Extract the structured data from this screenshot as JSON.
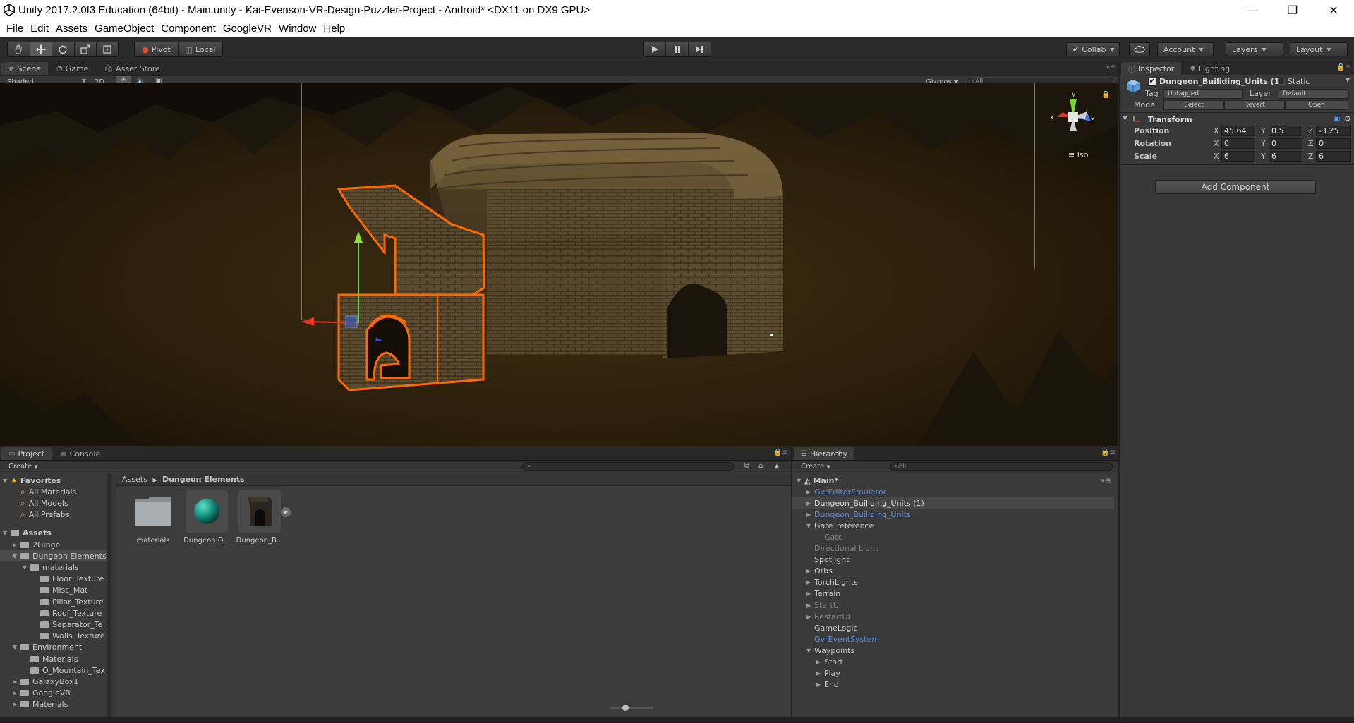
{
  "window": {
    "title": "Unity 2017.2.0f3 Education (64bit) - Main.unity - Kai-Evenson-VR-Design-Puzzler-Project - Android* <DX11 on DX9 GPU>",
    "minimize": "—",
    "restore": "❐",
    "close": "✕"
  },
  "menu": [
    "File",
    "Edit",
    "Assets",
    "GameObject",
    "Component",
    "GoogleVR",
    "Window",
    "Help"
  ],
  "toolbar": {
    "pivot": "Pivot",
    "local": "Local",
    "collab": "Collab",
    "account": "Account",
    "layers": "Layers",
    "layout": "Layout"
  },
  "scene": {
    "tabs": [
      "Scene",
      "Game",
      "Asset Store"
    ],
    "shading": "Shaded",
    "mode_2d": "2D",
    "gizmos": "Gizmos",
    "search_placeholder": "All",
    "iso_label": "Iso",
    "gizmo_axes": {
      "x": "x",
      "y": "y",
      "z": "z"
    }
  },
  "inspector": {
    "tabs": [
      "Inspector",
      "Lighting"
    ],
    "object_name": "Dungeon_Builiding_Units (1)",
    "static_label": "Static",
    "tag_label": "Tag",
    "tag_value": "Untagged",
    "layer_label": "Layer",
    "layer_value": "Default",
    "model_label": "Model",
    "model_buttons": [
      "Select",
      "Revert",
      "Open"
    ],
    "transform_title": "Transform",
    "rows": [
      {
        "label": "Position",
        "x": "45.64",
        "y": "0.5",
        "z": "-3.25"
      },
      {
        "label": "Rotation",
        "x": "0",
        "y": "0",
        "z": "0"
      },
      {
        "label": "Scale",
        "x": "6",
        "y": "6",
        "z": "6"
      }
    ],
    "add_component": "Add Component"
  },
  "project": {
    "tabs": [
      "Project",
      "Console"
    ],
    "create": "Create",
    "breadcrumb": [
      "Assets",
      "Dungeon Elements"
    ],
    "tree": [
      {
        "label": "Favorites",
        "indent": 0,
        "arrow": "▼",
        "kind": "star",
        "bold": true
      },
      {
        "label": "All Materials",
        "indent": 1,
        "kind": "search"
      },
      {
        "label": "All Models",
        "indent": 1,
        "kind": "search"
      },
      {
        "label": "All Prefabs",
        "indent": 1,
        "kind": "search"
      },
      {
        "label": "",
        "indent": 0,
        "kind": "spacer"
      },
      {
        "label": "Assets",
        "indent": 0,
        "arrow": "▼",
        "kind": "folder",
        "bold": true
      },
      {
        "label": "2Ginge",
        "indent": 1,
        "arrow": "▶",
        "kind": "folder"
      },
      {
        "label": "Dungeon Elements",
        "indent": 1,
        "arrow": "▼",
        "kind": "folder",
        "selected": true
      },
      {
        "label": "materials",
        "indent": 2,
        "arrow": "▼",
        "kind": "folder"
      },
      {
        "label": "Floor_Texture",
        "indent": 3,
        "kind": "folder"
      },
      {
        "label": "Misc_Mat",
        "indent": 3,
        "kind": "folder"
      },
      {
        "label": "Pillar_Texture",
        "indent": 3,
        "kind": "folder"
      },
      {
        "label": "Roof_Texture",
        "indent": 3,
        "kind": "folder"
      },
      {
        "label": "Separator_Te",
        "indent": 3,
        "kind": "folder"
      },
      {
        "label": "Walls_Texture",
        "indent": 3,
        "kind": "folder"
      },
      {
        "label": "Environment",
        "indent": 1,
        "arrow": "▼",
        "kind": "folder"
      },
      {
        "label": "Materials",
        "indent": 2,
        "kind": "folder"
      },
      {
        "label": "O_Mountain_Tex",
        "indent": 2,
        "kind": "folder"
      },
      {
        "label": "GalaxyBox1",
        "indent": 1,
        "arrow": "▶",
        "kind": "folder"
      },
      {
        "label": "GoogleVR",
        "indent": 1,
        "arrow": "▶",
        "kind": "folder"
      },
      {
        "label": "Materials",
        "indent": 1,
        "arrow": "▶",
        "kind": "folder"
      }
    ],
    "assets": [
      {
        "label": "materials",
        "kind": "folder"
      },
      {
        "label": "Dungeon O...",
        "kind": "material"
      },
      {
        "label": "Dungeon_B...",
        "kind": "model"
      }
    ]
  },
  "hierarchy": {
    "tab": "Hierarchy",
    "create": "Create",
    "search_placeholder": "All",
    "scene_name": "Main*",
    "items": [
      {
        "label": "GvrEditorEmulator",
        "indent": 1,
        "arrow": "▶",
        "style": "prefab"
      },
      {
        "label": "Dungeon_Builiding_Units (1)",
        "indent": 1,
        "arrow": "▶",
        "style": "selected"
      },
      {
        "label": "Dungeon_Builiding_Units",
        "indent": 1,
        "arrow": "▶",
        "style": "prefab"
      },
      {
        "label": "Gate_reference",
        "indent": 1,
        "arrow": "▼",
        "style": "normal"
      },
      {
        "label": "Gate",
        "indent": 2,
        "arrow": "",
        "style": "disabled"
      },
      {
        "label": "Directional Light",
        "indent": 1,
        "arrow": "",
        "style": "disabled"
      },
      {
        "label": "Spotlight",
        "indent": 1,
        "arrow": "",
        "style": "normal"
      },
      {
        "label": "Orbs",
        "indent": 1,
        "arrow": "▶",
        "style": "normal"
      },
      {
        "label": "TorchLights",
        "indent": 1,
        "arrow": "▶",
        "style": "normal"
      },
      {
        "label": "Terrain",
        "indent": 1,
        "arrow": "▶",
        "style": "normal"
      },
      {
        "label": "StartUI",
        "indent": 1,
        "arrow": "▶",
        "style": "disabled"
      },
      {
        "label": "RestartUI",
        "indent": 1,
        "arrow": "▶",
        "style": "disabled"
      },
      {
        "label": "GameLogic",
        "indent": 1,
        "arrow": "",
        "style": "normal"
      },
      {
        "label": "GvrEventSystem",
        "indent": 1,
        "arrow": "",
        "style": "prefab"
      },
      {
        "label": "Waypoints",
        "indent": 1,
        "arrow": "▼",
        "style": "normal"
      },
      {
        "label": "Start",
        "indent": 2,
        "arrow": "▶",
        "style": "normal"
      },
      {
        "label": "Play",
        "indent": 2,
        "arrow": "▶",
        "style": "normal"
      },
      {
        "label": "End",
        "indent": 2,
        "arrow": "▶",
        "style": "normal"
      }
    ]
  },
  "colors": {
    "selection_outline": "#ff6a00",
    "prefab_text": "#5c8fd8",
    "editor_bg": "#383838"
  }
}
